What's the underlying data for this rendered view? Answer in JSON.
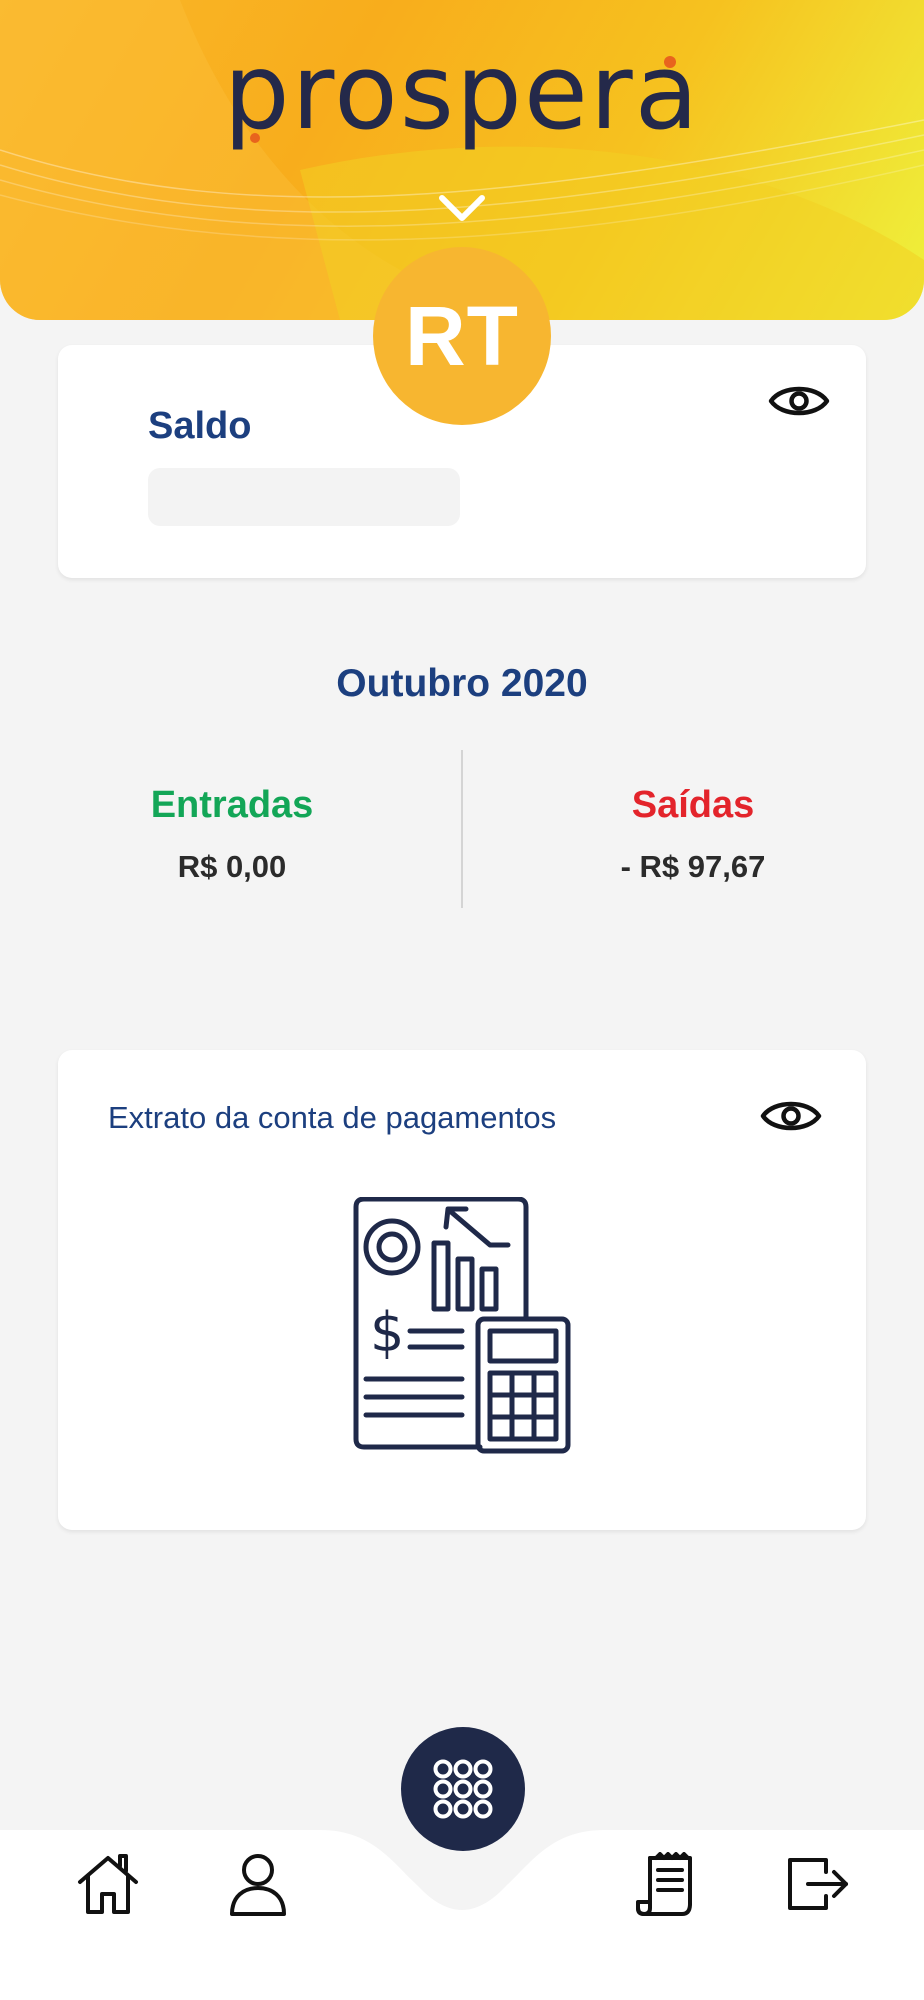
{
  "app": {
    "logo_text": "prospera"
  },
  "user": {
    "initials": "RT"
  },
  "balance": {
    "label": "Saldo"
  },
  "summary": {
    "month": "Outubro 2020",
    "entradas": {
      "label": "Entradas",
      "value": "R$ 0,00"
    },
    "saidas": {
      "label": "Saídas",
      "value": "- R$ 97,67"
    }
  },
  "statement": {
    "label": "Extrato da conta de pagamentos"
  },
  "colors": {
    "header_gradient": [
      "#fab82a",
      "#eef23c"
    ],
    "brand_navy": "#24294a",
    "title_blue": "#1c3f7f",
    "income_green": "#13a657",
    "expense_red": "#e3242b",
    "avatar_bg": "#f7b630"
  },
  "icons": {
    "header": "chevron-down-icon",
    "visibility": "eye-icon",
    "statement": "report-calculator-icon",
    "menu": "grid-menu-icon",
    "nav": [
      "home-icon",
      "profile-icon",
      "receipt-icon",
      "logout-icon"
    ]
  }
}
